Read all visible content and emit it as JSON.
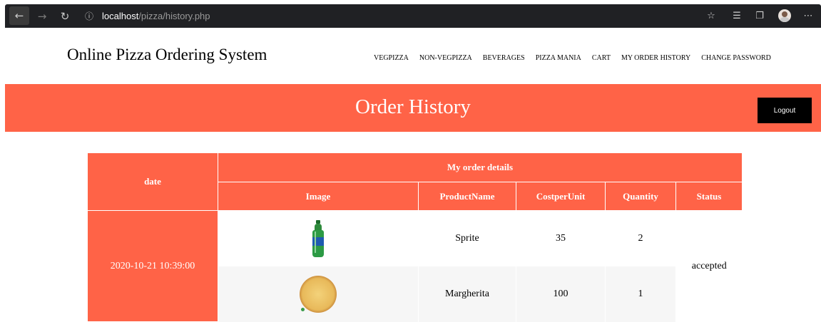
{
  "browser": {
    "url_host": "localhost",
    "url_path": "/pizza/history.php",
    "icons": [
      "back-icon",
      "forward-icon",
      "reload-icon",
      "info-icon",
      "star-icon",
      "favorites-icon",
      "collections-icon",
      "profile-icon",
      "more-icon"
    ]
  },
  "site": {
    "title": "Online Pizza Ordering System",
    "menu": [
      "VEGPIZZA",
      "NON-VEGPIZZA",
      "BEVERAGES",
      "PIZZA MANIA",
      "CART",
      "MY ORDER HISTORY",
      "CHANGE PASSWORD"
    ]
  },
  "banner": {
    "title": "Order History",
    "logout_label": "Logout",
    "color": "#ff6347"
  },
  "orders_table": {
    "date_header": "date",
    "group_header": "My order details",
    "columns": [
      "Image",
      "ProductName",
      "CostperUnit",
      "Quantity",
      "Status"
    ],
    "orders": [
      {
        "date": "2020-10-21 10:39:00",
        "status": "accepted",
        "items": [
          {
            "image": "sprite-bottle-image",
            "product": "Sprite",
            "cost": "35",
            "quantity": "2"
          },
          {
            "image": "margherita-pizza-image",
            "product": "Margherita",
            "cost": "100",
            "quantity": "1"
          }
        ]
      }
    ]
  }
}
